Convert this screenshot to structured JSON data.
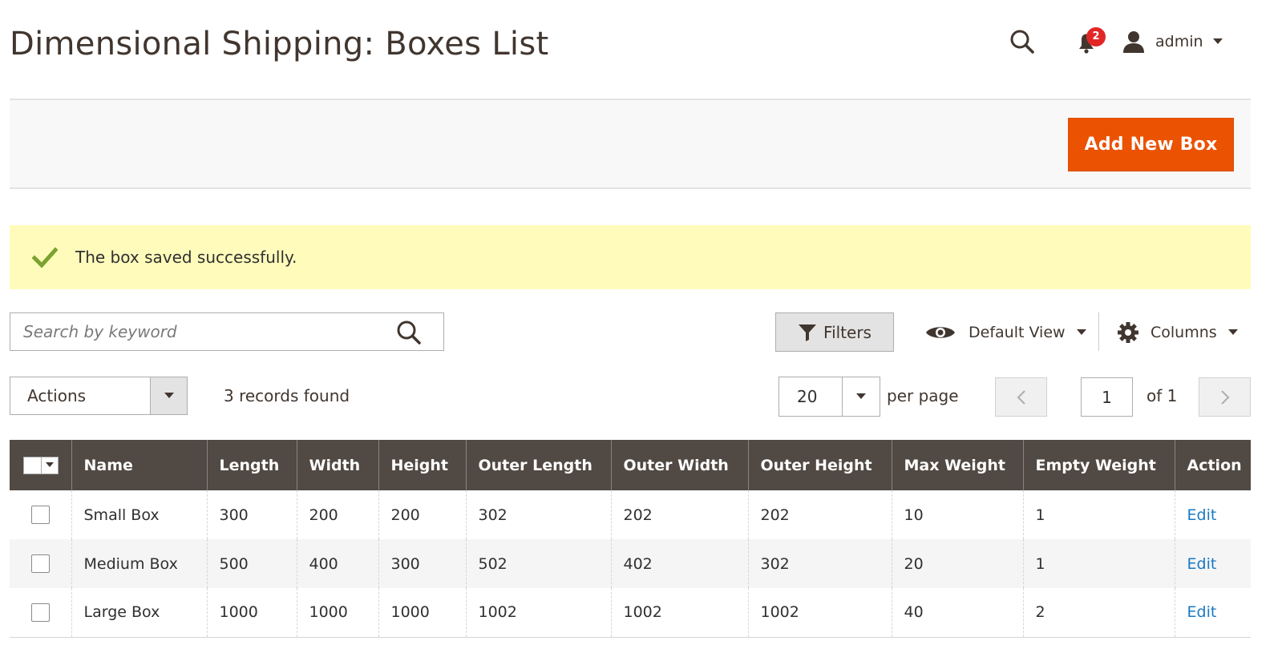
{
  "header": {
    "title": "Dimensional Shipping: Boxes List",
    "notifications_count": "2",
    "user_name": "admin"
  },
  "page_actions": {
    "add_button": "Add New Box"
  },
  "message": {
    "text": "The box saved successfully."
  },
  "toolbar": {
    "search_placeholder": "Search by keyword",
    "filters_label": "Filters",
    "view_label": "Default View",
    "columns_label": "Columns"
  },
  "grid_controls": {
    "actions_label": "Actions",
    "records_found": "3 records found",
    "per_page_value": "20",
    "per_page_label": "per page",
    "current_page": "1",
    "of_pages": "of 1"
  },
  "table": {
    "columns": [
      "Name",
      "Length",
      "Width",
      "Height",
      "Outer Length",
      "Outer Width",
      "Outer Height",
      "Max Weight",
      "Empty Weight",
      "Action"
    ],
    "rows": [
      [
        "Small Box",
        "300",
        "200",
        "200",
        "302",
        "202",
        "202",
        "10",
        "1",
        "Edit"
      ],
      [
        "Medium Box",
        "500",
        "400",
        "300",
        "502",
        "402",
        "302",
        "20",
        "1",
        "Edit"
      ],
      [
        "Large Box",
        "1000",
        "1000",
        "1000",
        "1002",
        "1002",
        "1002",
        "40",
        "2",
        "Edit"
      ]
    ]
  },
  "colors": {
    "accent": "#eb5202",
    "header_bg": "#514943",
    "message_bg": "#fffbbb",
    "link": "#1979c3",
    "success": "#79a22e",
    "badge": "#e22626"
  },
  "icons": {
    "search": "search-icon",
    "bell": "bell-icon",
    "user": "user-icon",
    "check": "check-icon",
    "filter": "funnel-icon",
    "eye": "eye-icon",
    "gear": "gear-icon"
  }
}
